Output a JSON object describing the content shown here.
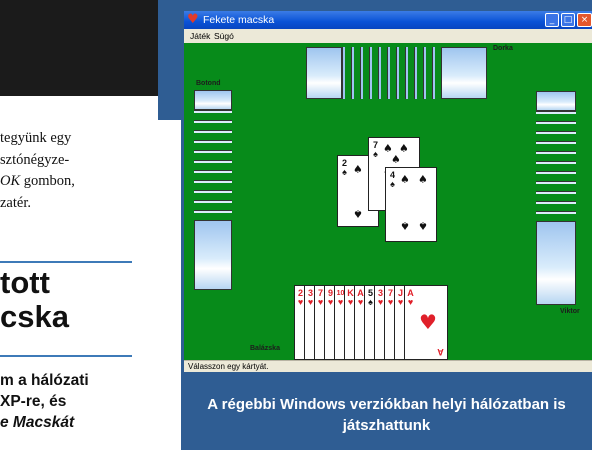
{
  "magazine": {
    "body_lines": [
      {
        "text": "tegyünk egy",
        "italic": false
      },
      {
        "text": "sztónégyze-",
        "italic": false
      },
      {
        "pre": "",
        "italic_part": "OK",
        "post": " gombon,"
      },
      {
        "text": "zatér.",
        "italic": false
      }
    ],
    "heading_lines": [
      "tott",
      "cska"
    ],
    "lead_lines": [
      {
        "text": "m a hálózati",
        "italic": false
      },
      {
        "text": "XP-re, és",
        "italic": false
      },
      {
        "text": "e Macskát",
        "italic": true
      }
    ]
  },
  "window": {
    "title": "Fekete macska",
    "icon": "heart-icon",
    "controls": {
      "minimize": "_",
      "maximize": "□",
      "close": "×"
    },
    "menu": {
      "game": "Játék",
      "help": "Súgó"
    },
    "status": "Válasszon egy kártyát."
  },
  "game": {
    "players": {
      "north": "Dorka",
      "west": "Botond",
      "east": "Viktor",
      "south": "Balázska"
    },
    "trick": [
      {
        "rank": "2",
        "suit": "♠"
      },
      {
        "rank": "7",
        "suit": "♠"
      },
      {
        "rank": "4",
        "suit": "♠"
      }
    ],
    "hand": [
      {
        "rank": "2",
        "suit": "♥"
      },
      {
        "rank": "3",
        "suit": "♥"
      },
      {
        "rank": "7",
        "suit": "♥"
      },
      {
        "rank": "9",
        "suit": "♥"
      },
      {
        "rank": "10",
        "suit": "♥"
      },
      {
        "rank": "K",
        "suit": "♥"
      },
      {
        "rank": "A",
        "suit": "♥"
      },
      {
        "rank": "5",
        "suit": "♠"
      },
      {
        "rank": "3",
        "suit": "♥"
      },
      {
        "rank": "7",
        "suit": "♥"
      },
      {
        "rank": "J",
        "suit": "♥"
      },
      {
        "rank": "A",
        "suit": "♥"
      }
    ],
    "colors": {
      "felt": "#078b1a",
      "red_suit": "#e0202a",
      "black_suit": "#111111"
    }
  },
  "caption": {
    "line1": "A régebbi Windows verziókban helyi hálózatban is",
    "line2": "játszhattunk"
  }
}
